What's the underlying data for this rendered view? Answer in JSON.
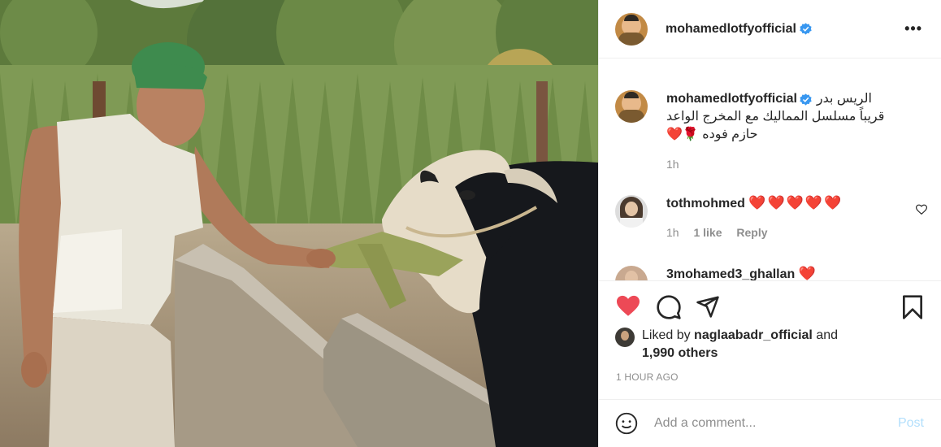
{
  "post": {
    "username": "mohamedlotfyofficial",
    "caption_line1": "الريس بدر",
    "caption_line2": "قريباً مسلسل المماليك مع المخرج الواعد",
    "caption_line3": "حازم فوده 🌹❤️",
    "caption_time": "1h",
    "icons": {
      "verified": "verified-badge-icon",
      "more": "more-options-icon"
    }
  },
  "comments": [
    {
      "username": "tothmohmed",
      "text": "❤️❤️❤️❤️❤️",
      "time": "1h",
      "likes": "1 like",
      "reply": "Reply"
    },
    {
      "username": "3mohamed3_ghallan",
      "text": "❤️"
    }
  ],
  "actions": {
    "liked": true,
    "heart_color": "#ed4956",
    "icons": [
      "heart-icon",
      "comment-icon",
      "share-icon",
      "bookmark-icon"
    ]
  },
  "likes": {
    "prefix": "Liked by",
    "user": "naglaabadr_official",
    "and": "and",
    "others": "1,990 others"
  },
  "timestamp": "1 HOUR AGO",
  "add_comment": {
    "placeholder": "Add a comment...",
    "post_label": "Post"
  },
  "colors": {
    "text": "#262626",
    "muted": "#8e8e8e",
    "verified": "#3897f0",
    "post_disabled": "#b2dffc"
  }
}
